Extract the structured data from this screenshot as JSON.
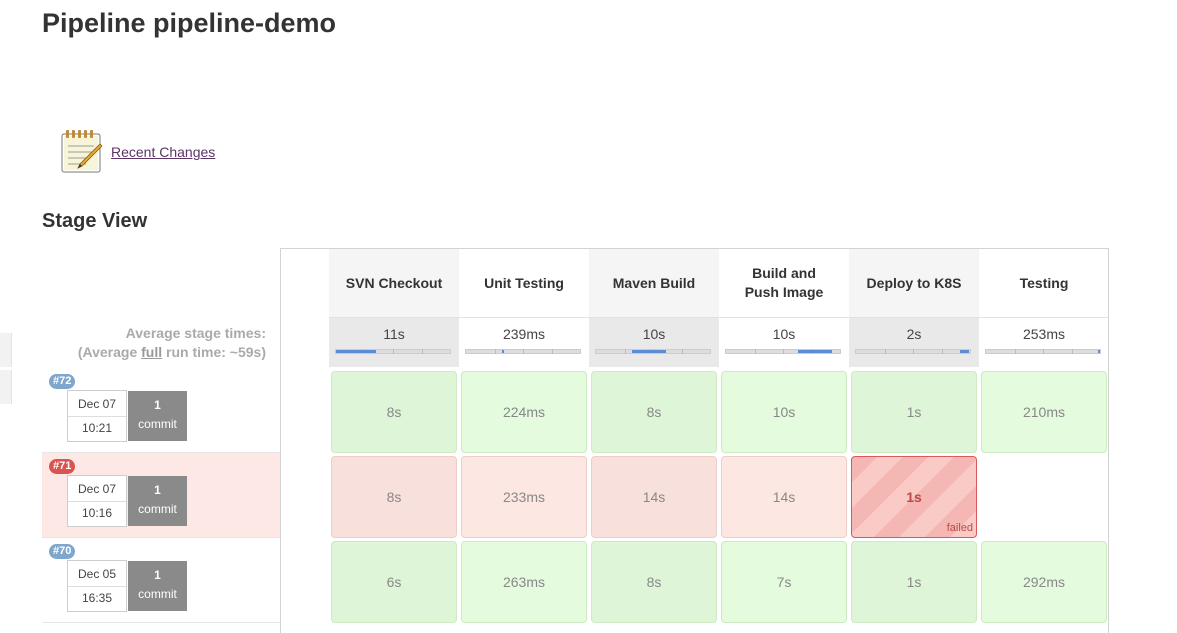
{
  "page": {
    "title": "Pipeline pipeline-demo",
    "recent_changes_label": "Recent Changes",
    "stage_view_title": "Stage View"
  },
  "avg": {
    "line1": "Average stage times:",
    "line2_prefix": "(Average ",
    "line2_link": "full",
    "line2_suffix": " run time: ~59s)"
  },
  "stages": [
    {
      "name": "SVN Checkout",
      "avg": "11s",
      "share": 0.35
    },
    {
      "name": "Unit Testing",
      "avg": "239ms",
      "share": 0.01
    },
    {
      "name": "Maven Build",
      "avg": "10s",
      "share": 0.3
    },
    {
      "name": "Build and Push Image",
      "avg": "10s",
      "share": 0.3
    },
    {
      "name": "Deploy to K8S",
      "avg": "2s",
      "share": 0.08
    },
    {
      "name": "Testing",
      "avg": "253ms",
      "share": 0.01
    }
  ],
  "runs": [
    {
      "id": "#72",
      "status": "success",
      "date": "Dec 07",
      "time": "10:21",
      "commits": "1",
      "commit_label": "commit",
      "durations": [
        "8s",
        "224ms",
        "8s",
        "10s",
        "1s",
        "210ms"
      ]
    },
    {
      "id": "#71",
      "status": "failed",
      "date": "Dec 07",
      "time": "10:16",
      "commits": "1",
      "commit_label": "commit",
      "durations": [
        "8s",
        "233ms",
        "14s",
        "14s",
        "1s",
        ""
      ],
      "failed_label": "failed"
    },
    {
      "id": "#70",
      "status": "success",
      "date": "Dec 05",
      "time": "16:35",
      "commits": "1",
      "commit_label": "commit",
      "durations": [
        "6s",
        "263ms",
        "8s",
        "7s",
        "1s",
        "292ms"
      ]
    }
  ],
  "colors": {
    "success": "#dff5d7",
    "failure": "#f8e0dc",
    "failed_stage": "#d95a5a",
    "progress": "#5b8cd8"
  }
}
